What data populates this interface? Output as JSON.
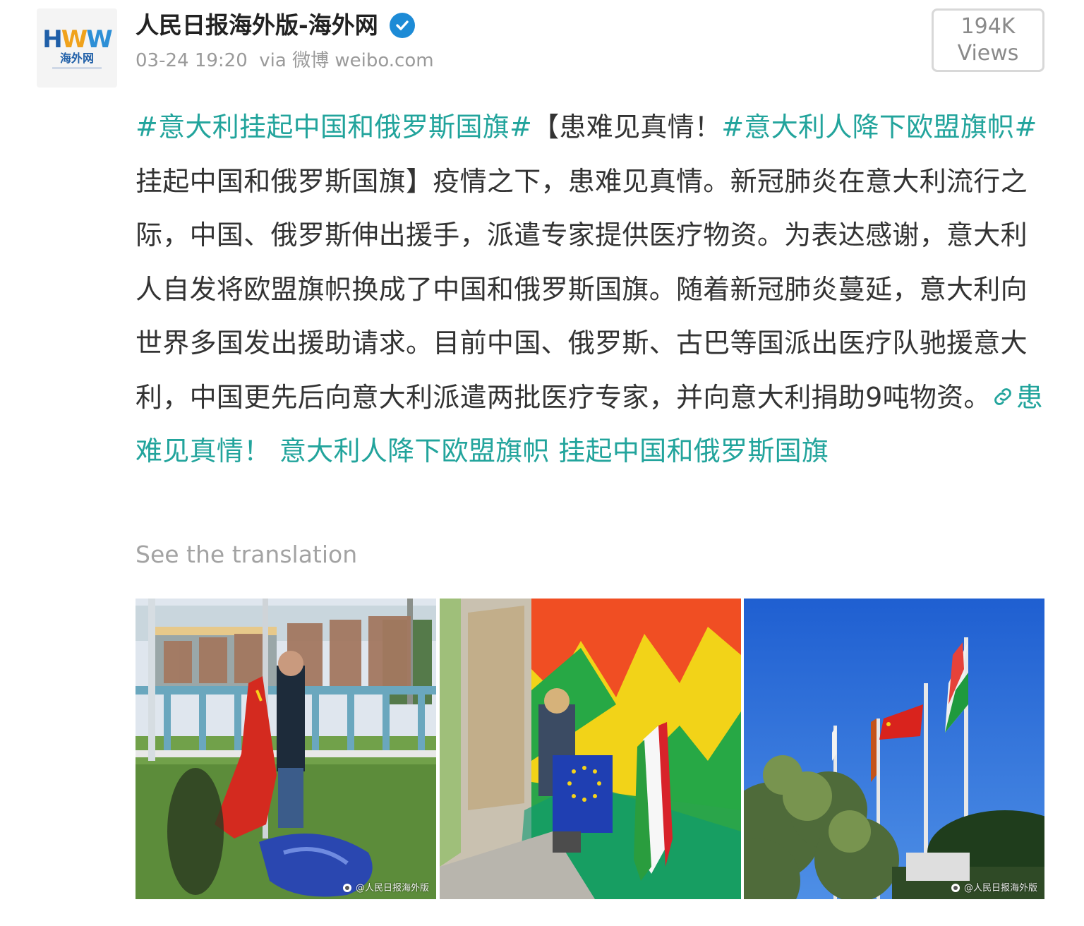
{
  "author": {
    "name": "人民日报海外版-海外网",
    "avatar_logo": "HWW",
    "avatar_sub": "海外网",
    "verified_icon": "verified-badge-icon"
  },
  "meta": {
    "time": "03-24 19:20",
    "via": "via 微博 weibo.com"
  },
  "views": {
    "count": "194K",
    "label": "Views"
  },
  "post": {
    "tag1": "#意大利挂起中国和俄罗斯国旗#",
    "text1": "【患难见真情！",
    "tag2": "#意大利人降下欧盟旗帜#",
    "text2": " 挂起中国和俄罗斯国旗】疫情之下，患难见真情。新冠肺炎在意大利流行之际，中国、俄罗斯伸出援手，派遣专家提供医疗物资。为表达感谢，意大利人自发将欧盟旗帜换成了中国和俄罗斯国旗。随着新冠肺炎蔓延，意大利向世界多国发出援助请求。目前中国、俄罗斯、古巴等国派出医疗队驰援意大利，中国更先后向意大利派遣两批医疗专家，并向意大利捐助9吨物资。",
    "link_text": "患难见真情！ 意大利人降下欧盟旗帜 挂起中国和俄罗斯国旗",
    "link_icon": "link-icon"
  },
  "translate": "See the translation",
  "photos": [
    {
      "name": "photo-man-raising-chinese-flag",
      "watermark": "@人民日报海外版"
    },
    {
      "name": "photo-woman-holding-eu-flag",
      "watermark": ""
    },
    {
      "name": "photo-flags-on-poles",
      "watermark": "@人民日报海外版"
    }
  ],
  "colors": {
    "accent": "#22a49c",
    "verified": "#1d8bd6",
    "muted": "#9a9a9a"
  }
}
